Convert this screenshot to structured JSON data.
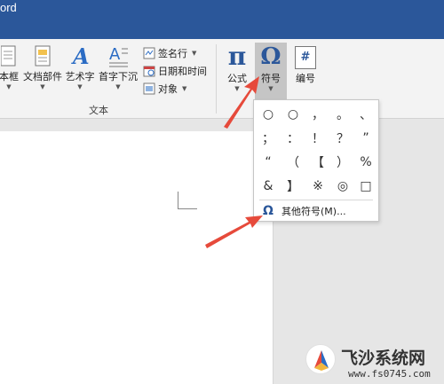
{
  "window": {
    "title_fragment": "ord"
  },
  "ribbon": {
    "text_group": {
      "label": "文本",
      "buttons": [
        {
          "label": "本框"
        },
        {
          "label": "文档部件"
        },
        {
          "label": "艺术字"
        },
        {
          "label": "首字下沉"
        }
      ],
      "small_items": [
        {
          "label": "签名行"
        },
        {
          "label": "日期和时间"
        },
        {
          "label": "对象"
        }
      ]
    },
    "symbols_group": {
      "formula": {
        "label": "公式",
        "icon_glyph": "π"
      },
      "symbol": {
        "label": "符号",
        "icon_glyph": "Ω"
      },
      "number": {
        "label": "编号",
        "icon_glyph": "#"
      }
    }
  },
  "symbol_dropdown": {
    "symbols": [
      "○",
      "○",
      "，",
      "。",
      "、",
      "；",
      "：",
      "！",
      "？",
      "”",
      "“",
      "（",
      "【",
      "）",
      "%",
      "&",
      "】",
      "※",
      "◎",
      "□"
    ],
    "more_symbols": {
      "icon_glyph": "Ω",
      "label": "其他符号(M)..."
    }
  },
  "watermark": {
    "title": "飞沙系统网",
    "url": "www.fs0745.com"
  },
  "colors": {
    "title_bar": "#2b579a",
    "arrow": "#e64a3b"
  }
}
